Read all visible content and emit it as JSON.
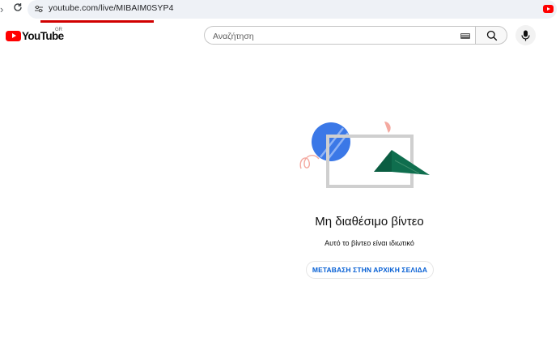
{
  "browser": {
    "url": "youtube.com/live/MIBAIM0SYP4"
  },
  "header": {
    "logo_text": "YouTube",
    "country_code": "GR",
    "search_placeholder": "Αναζήτηση"
  },
  "main": {
    "title": "Μη διαθέσιμο βίντεο",
    "subtitle": "Αυτό το βίντεο είναι ιδιωτικό",
    "home_button_label": "ΜΕΤΑΒΑΣΗ ΣΤΗΝ ΑΡΧΙΚΗ ΣΕΛΙΔΑ"
  },
  "colors": {
    "brand_red": "#ff0000",
    "link_blue": "#065fd4",
    "circle_blue": "#3b78e7",
    "triangle_green": "#0b5d42",
    "accent_pink": "#f4a9a0"
  },
  "icons": [
    "back-arrow-icon",
    "reload-icon",
    "site-info-icon",
    "youtube-tab-icon",
    "youtube-logo-icon",
    "keyboard-icon",
    "search-icon",
    "mic-icon"
  ]
}
